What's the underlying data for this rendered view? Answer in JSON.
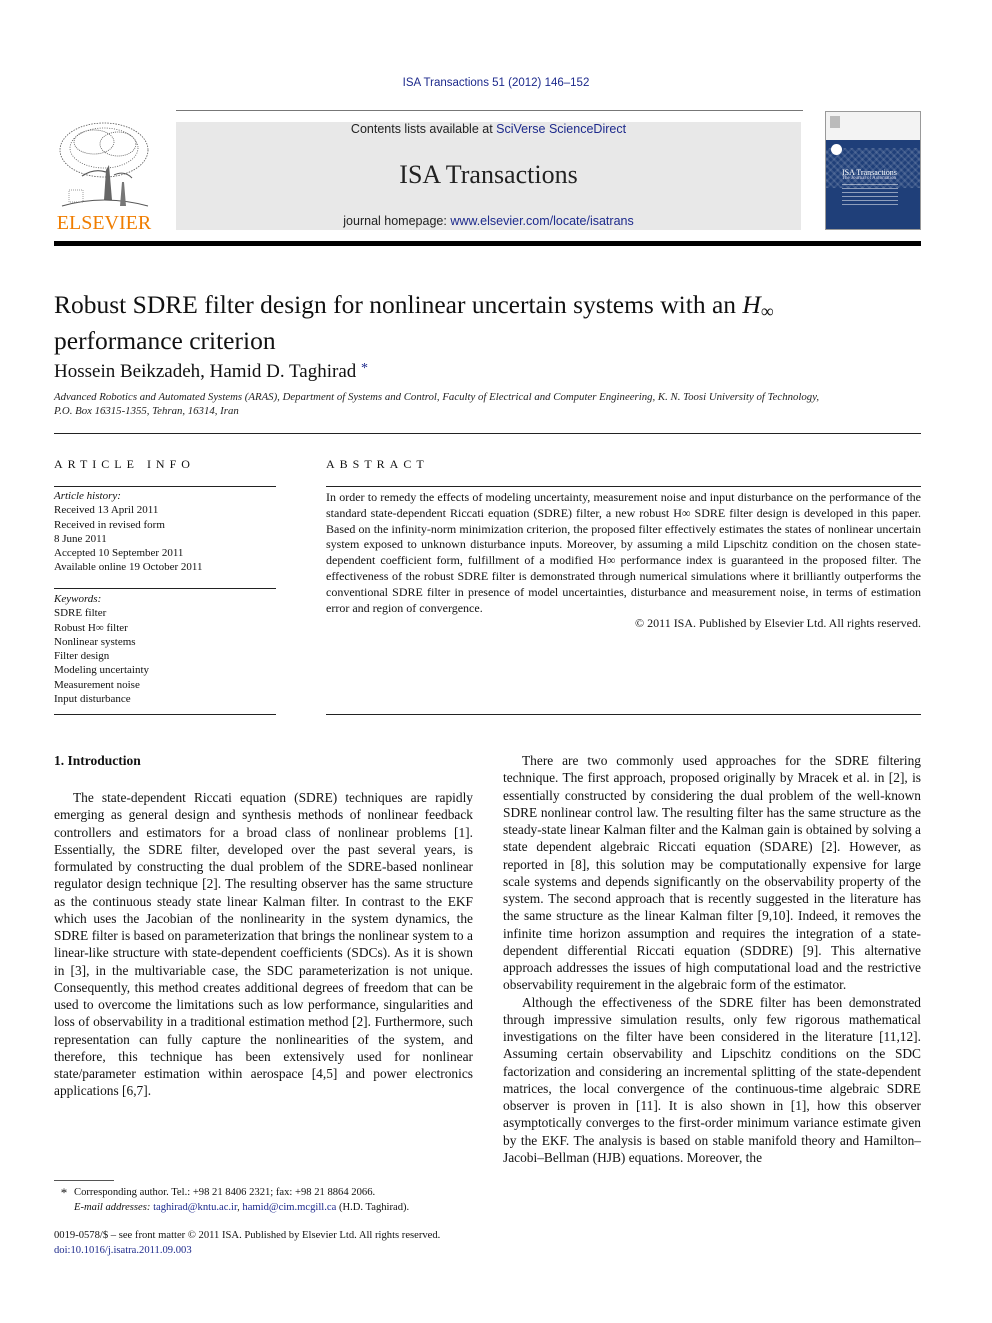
{
  "header": {
    "citation": "ISA Transactions 51 (2012) 146–152",
    "contents_prefix": "Contents lists available at ",
    "contents_link": "SciVerse ScienceDirect",
    "journal_title": "ISA Transactions",
    "homepage_prefix": "journal homepage: ",
    "homepage_link": "www.elsevier.com/locate/isatrans",
    "publisher_logo_text": "ELSEVIER",
    "cover": {
      "title": "ISA Transactions",
      "subtitle": "The Journal of Automation"
    },
    "colors": {
      "link": "#1d2a8c",
      "elsevier_orange": "#f07d00",
      "masthead_bg": "#e8e8e8",
      "cover_blue": "#1f3f79"
    }
  },
  "article": {
    "title_part1": "Robust SDRE filter design for nonlinear uncertain systems with an ",
    "title_math": "H",
    "title_math_sub": "∞",
    "title_part2": "performance criterion",
    "authors": "Hossein Beikzadeh, Hamid D. Taghirad",
    "author_mark": "*",
    "affiliation_line1": "Advanced Robotics and Automated Systems (ARAS), Department of Systems and Control, Faculty of Electrical and Computer Engineering, K. N. Toosi University of Technology,",
    "affiliation_line2": "P.O. Box 16315-1355, Tehran, 16314, Iran"
  },
  "article_info": {
    "heading": "ARTICLE INFO",
    "history_label": "Article history:",
    "history": [
      "Received 13 April 2011",
      "Received in revised form",
      "8 June 2011",
      "Accepted 10 September 2011",
      "Available online 19 October 2011"
    ],
    "keywords_label": "Keywords:",
    "keywords": [
      "SDRE filter",
      "Robust H∞ filter",
      "Nonlinear systems",
      "Filter design",
      "Modeling uncertainty",
      "Measurement noise",
      "Input disturbance"
    ]
  },
  "abstract": {
    "heading": "ABSTRACT",
    "text": "In order to remedy the effects of modeling uncertainty, measurement noise and input disturbance on the performance of the standard state-dependent Riccati equation (SDRE) filter, a new robust H∞ SDRE filter design is developed in this paper. Based on the infinity-norm minimization criterion, the proposed filter effectively estimates the states of nonlinear uncertain system exposed to unknown disturbance inputs. Moreover, by assuming a mild Lipschitz condition on the chosen state-dependent coefficient form, fulfillment of a modified H∞ performance index is guaranteed in the proposed filter. The effectiveness of the robust SDRE filter is demonstrated through numerical simulations where it brilliantly outperforms the conventional SDRE filter in presence of model uncertainties, disturbance and measurement noise, in terms of estimation error and region of convergence.",
    "copyright": "© 2011 ISA. Published by Elsevier Ltd. All rights reserved."
  },
  "intro": {
    "heading": "1.  Introduction",
    "left_paragraphs": [
      "The state-dependent Riccati equation (SDRE) techniques are rapidly emerging as general design and synthesis methods of nonlinear feedback controllers and estimators for a broad class of nonlinear problems [1]. Essentially, the SDRE filter, developed over the past several years, is formulated by constructing the dual problem of the SDRE-based nonlinear regulator design technique [2]. The resulting observer has the same structure as the continuous steady state linear Kalman filter. In contrast to the EKF which uses the Jacobian of the nonlinearity in the system dynamics, the SDRE filter is based on parameterization that brings the nonlinear system to a linear-like structure with state-dependent coefficients (SDCs). As it is shown in [3], in the multivariable case, the SDC parameterization is not unique. Consequently, this method creates additional degrees of freedom that can be used to overcome the limitations such as low performance, singularities and loss of observability in a traditional estimation method [2]. Furthermore, such representation can fully capture the nonlinearities of the system, and therefore, this technique has been extensively used for nonlinear state/parameter estimation within aerospace [4,5] and power electronics applications [6,7]."
    ],
    "right_paragraphs": [
      "There are two commonly used approaches for the SDRE filtering technique. The first approach, proposed originally by Mracek et al. in [2], is essentially constructed by considering the dual problem of the well-known SDRE nonlinear control law. The resulting filter has the same structure as the steady-state linear Kalman filter and the Kalman gain is obtained by solving a state dependent algebraic Riccati equation (SDARE) [2]. However, as reported in [8], this solution may be computationally expensive for large scale systems and depends significantly on the observability property of the system. The second approach that is recently suggested in the literature has the same structure as the linear Kalman filter [9,10]. Indeed, it removes the infinite time horizon assumption and requires the integration of a state-dependent differential Riccati equation (SDDRE) [9]. This alternative approach addresses the issues of high computational load and the restrictive observability requirement in the algebraic form of the estimator.",
      "Although the effectiveness of the SDRE filter has been demonstrated through impressive simulation results, only few rigorous mathematical investigations on the filter have been considered in the literature [11,12]. Assuming certain observability and Lipschitz conditions on the SDC factorization and considering an incremental splitting of the state-dependent matrices, the local convergence of the continuous-time algebraic SDRE observer is proven in [11]. It is also shown in [1], how this observer asymptotically converges to the first-order minimum variance estimate given by the EKF. The analysis is based on stable manifold theory and Hamilton–Jacobi–Bellman (HJB) equations. Moreover, the"
    ]
  },
  "footnote": {
    "mark": "*",
    "corresponding": "Corresponding author. Tel.: +98 21 8406 2321; fax: +98 21 8864 2066.",
    "email_label": "E-mail addresses: ",
    "email1": "taghirad@kntu.ac.ir",
    "email_sep": ", ",
    "email2": "hamid@cim.mcgill.ca",
    "email_suffix": " (H.D. Taghirad)."
  },
  "front_matter": {
    "issn_line": "0019-0578/$ – see front matter © 2011 ISA. Published by Elsevier Ltd. All rights reserved.",
    "doi": "doi:10.1016/j.isatra.2011.09.003"
  }
}
